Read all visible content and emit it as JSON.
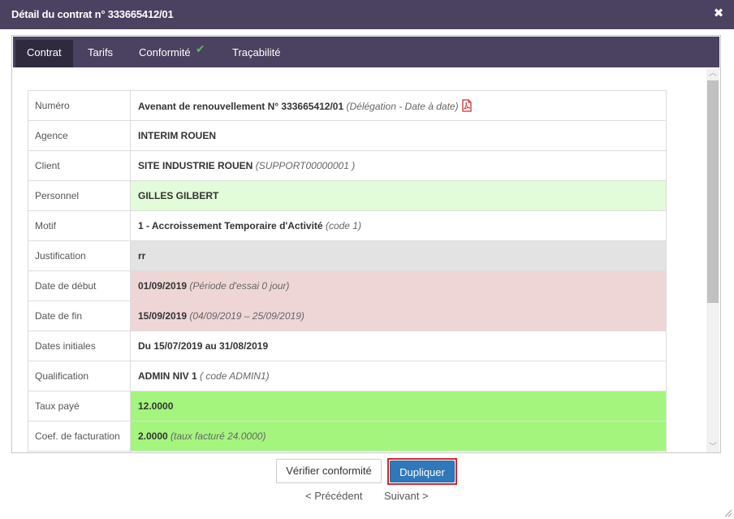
{
  "dialog": {
    "title": "Détail du contrat n° 333665412/01",
    "close_label": "✖"
  },
  "tabs": [
    {
      "label": "Contrat",
      "active": true
    },
    {
      "label": "Tarifs",
      "active": false
    },
    {
      "label": "Conformité",
      "active": false,
      "status_icon": "check-icon"
    },
    {
      "label": "Traçabilité",
      "active": false
    }
  ],
  "rows": {
    "numero": {
      "label": "Numéro",
      "value": "Avenant de renouvellement N° 333665412/01",
      "note": "(Délégation - Date à date)",
      "icon": "pdf-icon"
    },
    "agence": {
      "label": "Agence",
      "value": "INTERIM ROUEN"
    },
    "client": {
      "label": "Client",
      "value": "SITE INDUSTRIE ROUEN",
      "note": "(SUPPORT00000001 )"
    },
    "personnel": {
      "label": "Personnel",
      "value": "GILLES GILBERT"
    },
    "motif": {
      "label": "Motif",
      "value": "1 - Accroissement Temporaire d'Activité",
      "note": "(code 1)"
    },
    "justification": {
      "label": "Justification",
      "value": "rr"
    },
    "date_debut": {
      "label": "Date de début",
      "value": "01/09/2019",
      "note": "(Période d'essai 0 jour)"
    },
    "date_fin": {
      "label": "Date de fin",
      "value": "15/09/2019",
      "note": "(04/09/2019 – 25/09/2019)"
    },
    "dates_initiales": {
      "label": "Dates initiales",
      "value": "Du 15/07/2019 au 31/08/2019"
    },
    "qualification": {
      "label": "Qualification",
      "value": "ADMIN NIV 1",
      "note": "( code ADMIN1)"
    },
    "taux_paye": {
      "label": "Taux payé",
      "value": "12.0000"
    },
    "coef_facturation": {
      "label": "Coef. de facturation",
      "value": "2.0000",
      "note": "(taux facturé 24.0000)"
    }
  },
  "colors": {
    "header_bg": "#4b4160",
    "tab_active_bg": "#2f2a3d",
    "light_green": "#e2fbd8",
    "gray": "#e3e3e3",
    "pink": "#efd6d6",
    "green": "#a4f57e",
    "primary_button": "#3078b9",
    "highlight_outline": "#d9262b"
  },
  "footer": {
    "verify_button": "Vérifier conformité",
    "duplicate_button": "Dupliquer",
    "previous_link": "< Précédent",
    "next_link": "Suivant >"
  }
}
